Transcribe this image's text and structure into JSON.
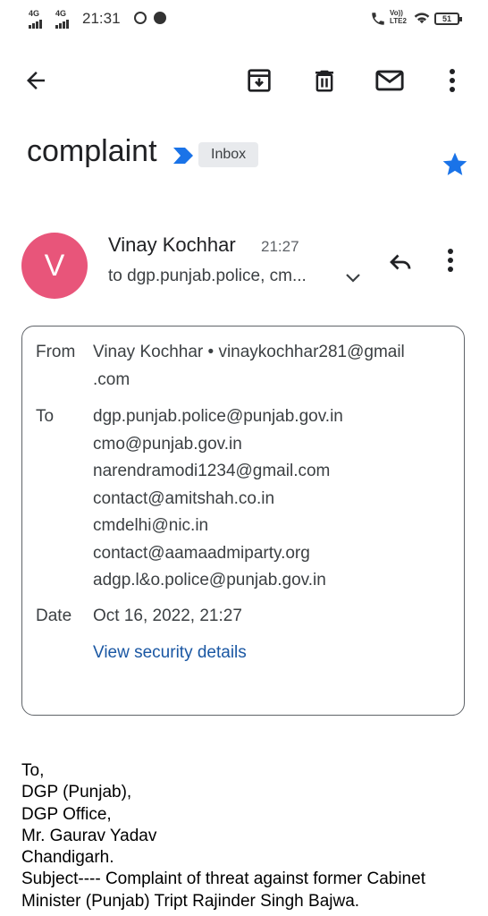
{
  "status_bar": {
    "signal1": "4G",
    "signal2": "4G",
    "time": "21:31",
    "volte": "Vo)) LTE2",
    "battery": "51"
  },
  "email": {
    "subject": "complaint",
    "label": "Inbox",
    "sender_name": "Vinay Kochhar",
    "time": "21:27",
    "avatar_letter": "V",
    "to_summary": "to dgp.punjab.police, cm...",
    "details": {
      "from_label": "From",
      "from_line1": "Vinay Kochhar • vinaykochhar281@gmail",
      "from_line2": ".com",
      "to_label": "To",
      "to": [
        "dgp.punjab.police@punjab.gov.in",
        "cmo@punjab.gov.in",
        "narendramodi1234@gmail.com",
        "contact@amitshah.co.in",
        "cmdelhi@nic.in",
        "contact@aamaadmiparty.org",
        "adgp.l&o.police@punjab.gov.in"
      ],
      "date_label": "Date",
      "date": "Oct 16, 2022, 21:27",
      "security_link": "View security details"
    },
    "body_lines": [
      "To,",
      "DGP (Punjab),",
      "DGP Office,",
      "Mr. Gaurav Yadav",
      "Chandigarh.",
      "Subject---- Complaint of threat against former Cabinet",
      "Minister (Punjab) Tript Rajinder Singh Bajwa."
    ]
  },
  "icons": {
    "back": "back-arrow-icon",
    "archive": "archive-icon",
    "delete": "delete-icon",
    "mark_unread": "mail-icon",
    "more": "more-vert-icon",
    "star": "star-icon",
    "reply": "reply-icon",
    "expand": "chevron-down-icon"
  },
  "colors": {
    "avatar": "#e8557a",
    "star": "#1a73e8",
    "label_arrow": "#1a73e8",
    "link": "#1a57a3"
  }
}
